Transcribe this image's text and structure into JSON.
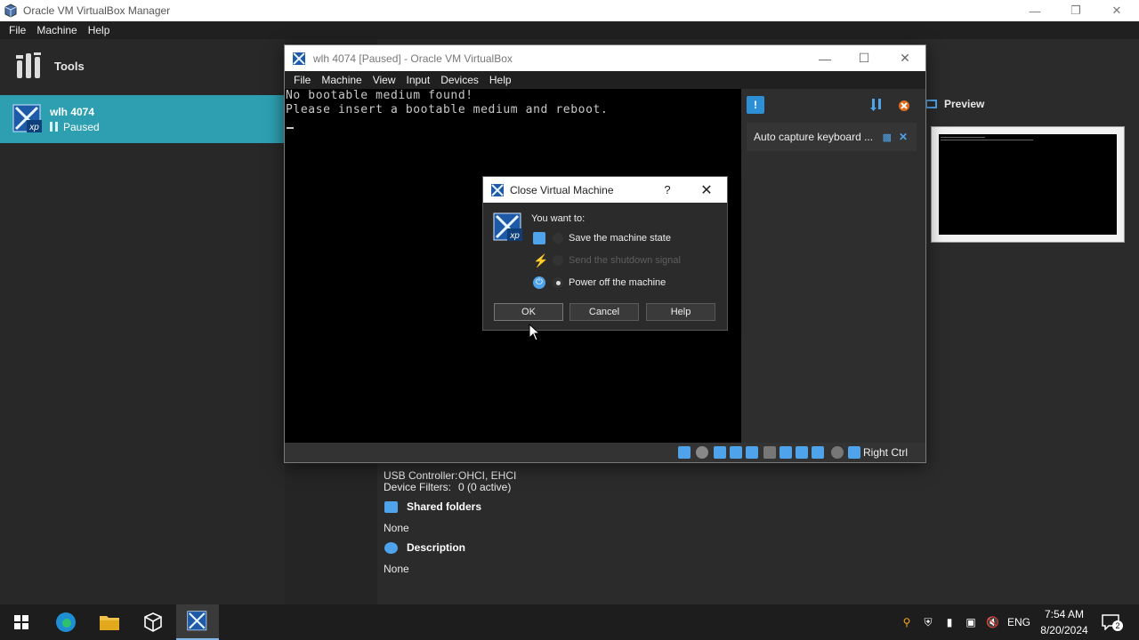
{
  "manager": {
    "title": "Oracle VM VirtualBox Manager",
    "menu": [
      "File",
      "Machine",
      "Help"
    ],
    "tools_label": "Tools",
    "vm": {
      "name": "wlh 4074",
      "state": "Paused"
    },
    "details": {
      "usb_controller_label": "USB Controller:",
      "usb_controller_value": "OHCI, EHCI",
      "device_filters_label": "Device Filters:",
      "device_filters_value": "0 (0 active)",
      "shared_folders_title": "Shared folders",
      "shared_folders_value": "None",
      "description_title": "Description",
      "description_value": "None"
    },
    "preview_label": "Preview"
  },
  "vm_window": {
    "title": "wlh 4074 [Paused] - Oracle VM VirtualBox",
    "menu": [
      "File",
      "Machine",
      "View",
      "Input",
      "Devices",
      "Help"
    ],
    "console_lines": [
      "No bootable medium found!",
      "Please insert a bootable medium and reboot."
    ],
    "notification": "Auto capture keyboard ...",
    "host_key": "Right Ctrl"
  },
  "dialog": {
    "title": "Close Virtual Machine",
    "help_glyph": "?",
    "prompt": "You want to:",
    "options": [
      {
        "label": "Save the machine state",
        "selected": false,
        "enabled": true
      },
      {
        "label": "Send the shutdown signal",
        "selected": false,
        "enabled": false
      },
      {
        "label": "Power off the machine",
        "selected": true,
        "enabled": true
      }
    ],
    "buttons": {
      "ok": "OK",
      "cancel": "Cancel",
      "help": "Help"
    }
  },
  "taskbar": {
    "lang": "ENG",
    "time": "7:54 AM",
    "date": "8/20/2024",
    "notification_count": "2"
  },
  "colors": {
    "accent": "#2d9fb0",
    "icon_blue": "#4ea3ea",
    "taskbar": "#1d1d1d"
  }
}
